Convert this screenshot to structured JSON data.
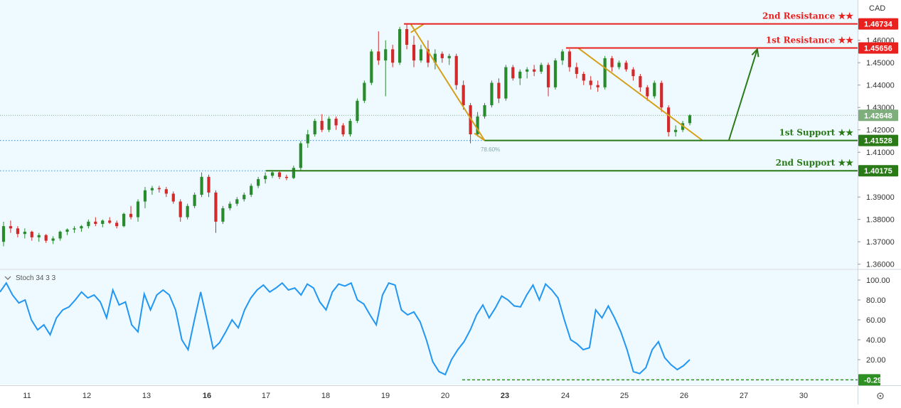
{
  "chart_data": [
    {
      "type": "candlestick",
      "title": "",
      "currency_label": "CAD",
      "x_ticks": [
        "11",
        "12",
        "13",
        "16",
        "17",
        "18",
        "19",
        "20",
        "23",
        "24",
        "25",
        "26",
        "27",
        "30"
      ],
      "x_bold_ticks": [
        "16",
        "23"
      ],
      "y_ticks": [
        "1.46000",
        "1.45000",
        "1.44000",
        "1.43000",
        "1.42000",
        "1.41000",
        "1.39000",
        "1.38000",
        "1.37000",
        "1.36000"
      ],
      "ylim": [
        1.358,
        1.478
      ],
      "xlim": [
        0,
        100
      ],
      "levels": [
        {
          "name": "2nd Resistance ★★",
          "value": 1.46734,
          "tag": "1.46734",
          "color": "#e8201e",
          "from": 47.1
        },
        {
          "name": "1st Resistance ★★",
          "value": 1.45656,
          "tag": "1.45656",
          "color": "#e8201e",
          "from": 66.0
        },
        {
          "name": "1st Support ★★",
          "value": 1.41528,
          "tag": "1.41528",
          "color": "#2b7a18",
          "from": 56.5
        },
        {
          "name": "2nd Support ★★",
          "value": 1.40175,
          "tag": "1.40175",
          "color": "#2b7a18",
          "from": 31.0
        }
      ],
      "current_price": {
        "value": 1.42648,
        "tag": "1.42648",
        "color": "#7fae7d"
      },
      "dotted_lines": [
        1.41528,
        1.40175
      ],
      "fib_label": "78.60%",
      "orange_lines": [
        {
          "x1": 47.9,
          "y1": 1.4672,
          "x2": 56.5,
          "y2": 1.4153
        },
        {
          "x1": 49.4,
          "y1": 1.4672,
          "x2": 47.9,
          "y2": 1.4635
        },
        {
          "x1": 67.4,
          "y1": 1.4566,
          "x2": 81.9,
          "y2": 1.4153
        },
        {
          "x1": 56.5,
          "y1": 1.4153,
          "x2": 55.3,
          "y2": 1.4185
        }
      ],
      "green_arrow": {
        "x1": 85.0,
        "y1": 1.4155,
        "x2": 88.3,
        "y2": 1.456
      },
      "candles": [
        [
          0.0,
          1.37,
          1.379,
          1.368,
          1.377
        ],
        [
          0.8,
          1.377,
          1.3795,
          1.374,
          1.376
        ],
        [
          1.6,
          1.376,
          1.377,
          1.372,
          1.3735
        ],
        [
          2.4,
          1.3735,
          1.376,
          1.3715,
          1.3745
        ],
        [
          3.2,
          1.3745,
          1.375,
          1.3705,
          1.372
        ],
        [
          4.0,
          1.372,
          1.374,
          1.37,
          1.373
        ],
        [
          4.8,
          1.373,
          1.3735,
          1.3695,
          1.3705
        ],
        [
          5.6,
          1.3705,
          1.3725,
          1.369,
          1.3715
        ],
        [
          6.4,
          1.3715,
          1.375,
          1.3705,
          1.3745
        ],
        [
          7.2,
          1.3745,
          1.376,
          1.373,
          1.3755
        ],
        [
          8.0,
          1.3755,
          1.377,
          1.374,
          1.376
        ],
        [
          8.8,
          1.376,
          1.3775,
          1.3745,
          1.377
        ],
        [
          9.6,
          1.377,
          1.38,
          1.376,
          1.379
        ],
        [
          10.4,
          1.379,
          1.381,
          1.377,
          1.378
        ],
        [
          11.2,
          1.378,
          1.38,
          1.3765,
          1.3795
        ],
        [
          12.0,
          1.3795,
          1.381,
          1.378,
          1.3785
        ],
        [
          12.8,
          1.3785,
          1.3795,
          1.376,
          1.377
        ],
        [
          13.6,
          1.377,
          1.383,
          1.3765,
          1.3825
        ],
        [
          14.4,
          1.3825,
          1.386,
          1.38,
          1.381
        ],
        [
          15.2,
          1.381,
          1.389,
          1.379,
          1.388
        ],
        [
          16.0,
          1.388,
          1.3945,
          1.385,
          1.393
        ],
        [
          16.8,
          1.393,
          1.395,
          1.391,
          1.394
        ],
        [
          17.6,
          1.394,
          1.395,
          1.392,
          1.3935
        ],
        [
          18.4,
          1.3935,
          1.3945,
          1.39,
          1.3915
        ],
        [
          19.2,
          1.3915,
          1.3925,
          1.387,
          1.388
        ],
        [
          20.0,
          1.388,
          1.389,
          1.379,
          1.381
        ],
        [
          20.8,
          1.381,
          1.387,
          1.38,
          1.386
        ],
        [
          21.6,
          1.386,
          1.392,
          1.385,
          1.391
        ],
        [
          22.4,
          1.391,
          1.401,
          1.39,
          1.399
        ],
        [
          23.2,
          1.399,
          1.4,
          1.39,
          1.392
        ],
        [
          24.0,
          1.392,
          1.393,
          1.374,
          1.379
        ],
        [
          24.8,
          1.379,
          1.386,
          1.378,
          1.385
        ],
        [
          25.6,
          1.385,
          1.388,
          1.384,
          1.387
        ],
        [
          26.4,
          1.387,
          1.39,
          1.386,
          1.389
        ],
        [
          27.2,
          1.389,
          1.392,
          1.388,
          1.391
        ],
        [
          28.0,
          1.391,
          1.396,
          1.39,
          1.395
        ],
        [
          28.8,
          1.395,
          1.399,
          1.394,
          1.398
        ],
        [
          29.6,
          1.398,
          1.401,
          1.396,
          1.3995
        ],
        [
          30.4,
          1.3995,
          1.402,
          1.3985,
          1.401
        ],
        [
          31.2,
          1.401,
          1.4015,
          1.398,
          1.399
        ],
        [
          32.0,
          1.399,
          1.4,
          1.3975,
          1.3985
        ],
        [
          32.8,
          1.3985,
          1.404,
          1.398,
          1.403
        ],
        [
          33.6,
          1.403,
          1.415,
          1.402,
          1.414
        ],
        [
          34.4,
          1.414,
          1.42,
          1.412,
          1.418
        ],
        [
          35.2,
          1.418,
          1.425,
          1.417,
          1.424
        ],
        [
          36.0,
          1.424,
          1.427,
          1.419,
          1.42
        ],
        [
          36.8,
          1.42,
          1.426,
          1.419,
          1.425
        ],
        [
          37.6,
          1.425,
          1.426,
          1.42,
          1.422
        ],
        [
          38.4,
          1.422,
          1.423,
          1.417,
          1.418
        ],
        [
          39.2,
          1.418,
          1.425,
          1.417,
          1.424
        ],
        [
          40.0,
          1.424,
          1.434,
          1.423,
          1.433
        ],
        [
          40.8,
          1.433,
          1.442,
          1.432,
          1.441
        ],
        [
          41.6,
          1.441,
          1.456,
          1.44,
          1.455
        ],
        [
          42.4,
          1.455,
          1.464,
          1.449,
          1.451
        ],
        [
          43.2,
          1.451,
          1.46,
          1.435,
          1.456
        ],
        [
          44.0,
          1.456,
          1.458,
          1.448,
          1.45
        ],
        [
          44.8,
          1.45,
          1.466,
          1.449,
          1.465
        ],
        [
          45.6,
          1.465,
          1.467,
          1.456,
          1.458
        ],
        [
          46.4,
          1.458,
          1.462,
          1.448,
          1.451
        ],
        [
          47.2,
          1.451,
          1.458,
          1.45,
          1.456
        ],
        [
          48.0,
          1.456,
          1.46,
          1.448,
          1.45
        ],
        [
          48.8,
          1.45,
          1.456,
          1.447,
          1.454
        ],
        [
          49.6,
          1.454,
          1.455,
          1.45,
          1.452
        ],
        [
          50.4,
          1.452,
          1.454,
          1.449,
          1.453
        ],
        [
          51.2,
          1.453,
          1.454,
          1.438,
          1.44
        ],
        [
          52.0,
          1.44,
          1.442,
          1.429,
          1.431
        ],
        [
          52.8,
          1.431,
          1.432,
          1.414,
          1.418
        ],
        [
          53.6,
          1.418,
          1.428,
          1.417,
          1.426
        ],
        [
          54.4,
          1.426,
          1.432,
          1.425,
          1.431
        ],
        [
          55.2,
          1.431,
          1.442,
          1.43,
          1.441
        ],
        [
          56.0,
          1.441,
          1.443,
          1.432,
          1.434
        ],
        [
          56.8,
          1.434,
          1.449,
          1.433,
          1.448
        ],
        [
          57.6,
          1.448,
          1.449,
          1.442,
          1.443
        ],
        [
          58.4,
          1.443,
          1.447,
          1.44,
          1.446
        ],
        [
          59.2,
          1.446,
          1.448,
          1.443,
          1.447
        ],
        [
          60.0,
          1.447,
          1.449,
          1.444,
          1.446
        ],
        [
          60.8,
          1.446,
          1.45,
          1.445,
          1.449
        ],
        [
          61.6,
          1.449,
          1.45,
          1.435,
          1.439
        ],
        [
          62.4,
          1.439,
          1.452,
          1.438,
          1.451
        ],
        [
          63.2,
          1.451,
          1.456,
          1.449,
          1.455
        ],
        [
          64.0,
          1.455,
          1.456,
          1.446,
          1.448
        ],
        [
          64.8,
          1.448,
          1.45,
          1.443,
          1.445
        ],
        [
          65.6,
          1.445,
          1.446,
          1.44,
          1.442
        ],
        [
          66.4,
          1.442,
          1.444,
          1.438,
          1.44
        ],
        [
          67.2,
          1.44,
          1.442,
          1.437,
          1.439
        ],
        [
          68.0,
          1.439,
          1.453,
          1.438,
          1.452
        ],
        [
          68.8,
          1.452,
          1.453,
          1.446,
          1.448
        ],
        [
          69.6,
          1.448,
          1.451,
          1.447,
          1.45
        ],
        [
          70.4,
          1.45,
          1.451,
          1.446,
          1.447
        ],
        [
          71.2,
          1.447,
          1.448,
          1.442,
          1.444
        ],
        [
          72.0,
          1.444,
          1.445,
          1.437,
          1.439
        ],
        [
          72.8,
          1.439,
          1.44,
          1.433,
          1.435
        ],
        [
          73.6,
          1.435,
          1.442,
          1.434,
          1.441
        ],
        [
          74.4,
          1.441,
          1.442,
          1.428,
          1.43
        ],
        [
          75.2,
          1.43,
          1.431,
          1.417,
          1.419
        ],
        [
          76.0,
          1.419,
          1.422,
          1.417,
          1.42
        ],
        [
          76.8,
          1.42,
          1.424,
          1.419,
          1.423
        ],
        [
          77.6,
          1.423,
          1.427,
          1.422,
          1.4265
        ]
      ],
      "candle_x_scale": 0.535
    },
    {
      "type": "line",
      "indicator_label": "Stoch 34 3 3",
      "y_ticks": [
        "100.00",
        "80.00",
        "60.00",
        "40.00",
        "20.00"
      ],
      "ylim": [
        -5,
        110
      ],
      "current_value": {
        "value": -0.29,
        "tag": "-0.29",
        "color": "#2e8f22"
      },
      "color": "#2196f3",
      "series": [
        [
          0,
          88
        ],
        [
          2,
          97
        ],
        [
          4,
          85
        ],
        [
          6,
          77
        ],
        [
          8,
          80
        ],
        [
          10,
          60
        ],
        [
          12,
          50
        ],
        [
          14,
          55
        ],
        [
          16,
          45
        ],
        [
          18,
          62
        ],
        [
          20,
          70
        ],
        [
          22,
          73
        ],
        [
          24,
          80
        ],
        [
          26,
          88
        ],
        [
          28,
          82
        ],
        [
          30,
          85
        ],
        [
          32,
          78
        ],
        [
          34,
          62
        ],
        [
          36,
          90
        ],
        [
          38,
          75
        ],
        [
          40,
          78
        ],
        [
          42,
          55
        ],
        [
          44,
          48
        ],
        [
          46,
          86
        ],
        [
          48,
          70
        ],
        [
          50,
          85
        ],
        [
          52,
          90
        ],
        [
          54,
          85
        ],
        [
          56,
          70
        ],
        [
          58,
          40
        ],
        [
          60,
          30
        ],
        [
          62,
          60
        ],
        [
          64,
          88
        ],
        [
          66,
          60
        ],
        [
          68,
          31
        ],
        [
          70,
          37
        ],
        [
          72,
          48
        ],
        [
          74,
          60
        ],
        [
          76,
          52
        ],
        [
          78,
          70
        ],
        [
          80,
          82
        ],
        [
          82,
          90
        ],
        [
          84,
          95
        ],
        [
          86,
          88
        ],
        [
          88,
          92
        ],
        [
          90,
          97
        ],
        [
          92,
          90
        ],
        [
          94,
          92
        ],
        [
          96,
          85
        ],
        [
          98,
          96
        ],
        [
          100,
          92
        ],
        [
          102,
          78
        ],
        [
          104,
          70
        ],
        [
          106,
          88
        ],
        [
          108,
          96
        ],
        [
          110,
          94
        ],
        [
          112,
          97
        ],
        [
          114,
          80
        ],
        [
          116,
          76
        ],
        [
          118,
          65
        ],
        [
          120,
          55
        ],
        [
          122,
          85
        ],
        [
          124,
          97
        ],
        [
          126,
          95
        ],
        [
          128,
          70
        ],
        [
          130,
          65
        ],
        [
          132,
          68
        ],
        [
          134,
          58
        ],
        [
          136,
          40
        ],
        [
          138,
          18
        ],
        [
          140,
          8
        ],
        [
          142,
          5
        ],
        [
          144,
          20
        ],
        [
          146,
          30
        ],
        [
          148,
          38
        ],
        [
          150,
          50
        ],
        [
          152,
          65
        ],
        [
          154,
          75
        ],
        [
          156,
          62
        ],
        [
          158,
          72
        ],
        [
          160,
          84
        ],
        [
          162,
          80
        ],
        [
          164,
          74
        ],
        [
          166,
          73
        ],
        [
          168,
          85
        ],
        [
          170,
          95
        ],
        [
          172,
          80
        ],
        [
          174,
          96
        ],
        [
          176,
          90
        ],
        [
          178,
          82
        ],
        [
          180,
          60
        ],
        [
          182,
          40
        ],
        [
          184,
          36
        ],
        [
          186,
          30
        ],
        [
          188,
          32
        ],
        [
          190,
          70
        ],
        [
          192,
          62
        ],
        [
          194,
          74
        ],
        [
          196,
          62
        ],
        [
          198,
          48
        ],
        [
          200,
          30
        ],
        [
          202,
          8
        ],
        [
          204,
          6
        ],
        [
          206,
          12
        ],
        [
          208,
          30
        ],
        [
          210,
          38
        ],
        [
          212,
          22
        ],
        [
          214,
          15
        ],
        [
          216,
          10
        ],
        [
          218,
          14
        ],
        [
          220,
          20
        ]
      ],
      "x_scale_note": ""
    }
  ]
}
